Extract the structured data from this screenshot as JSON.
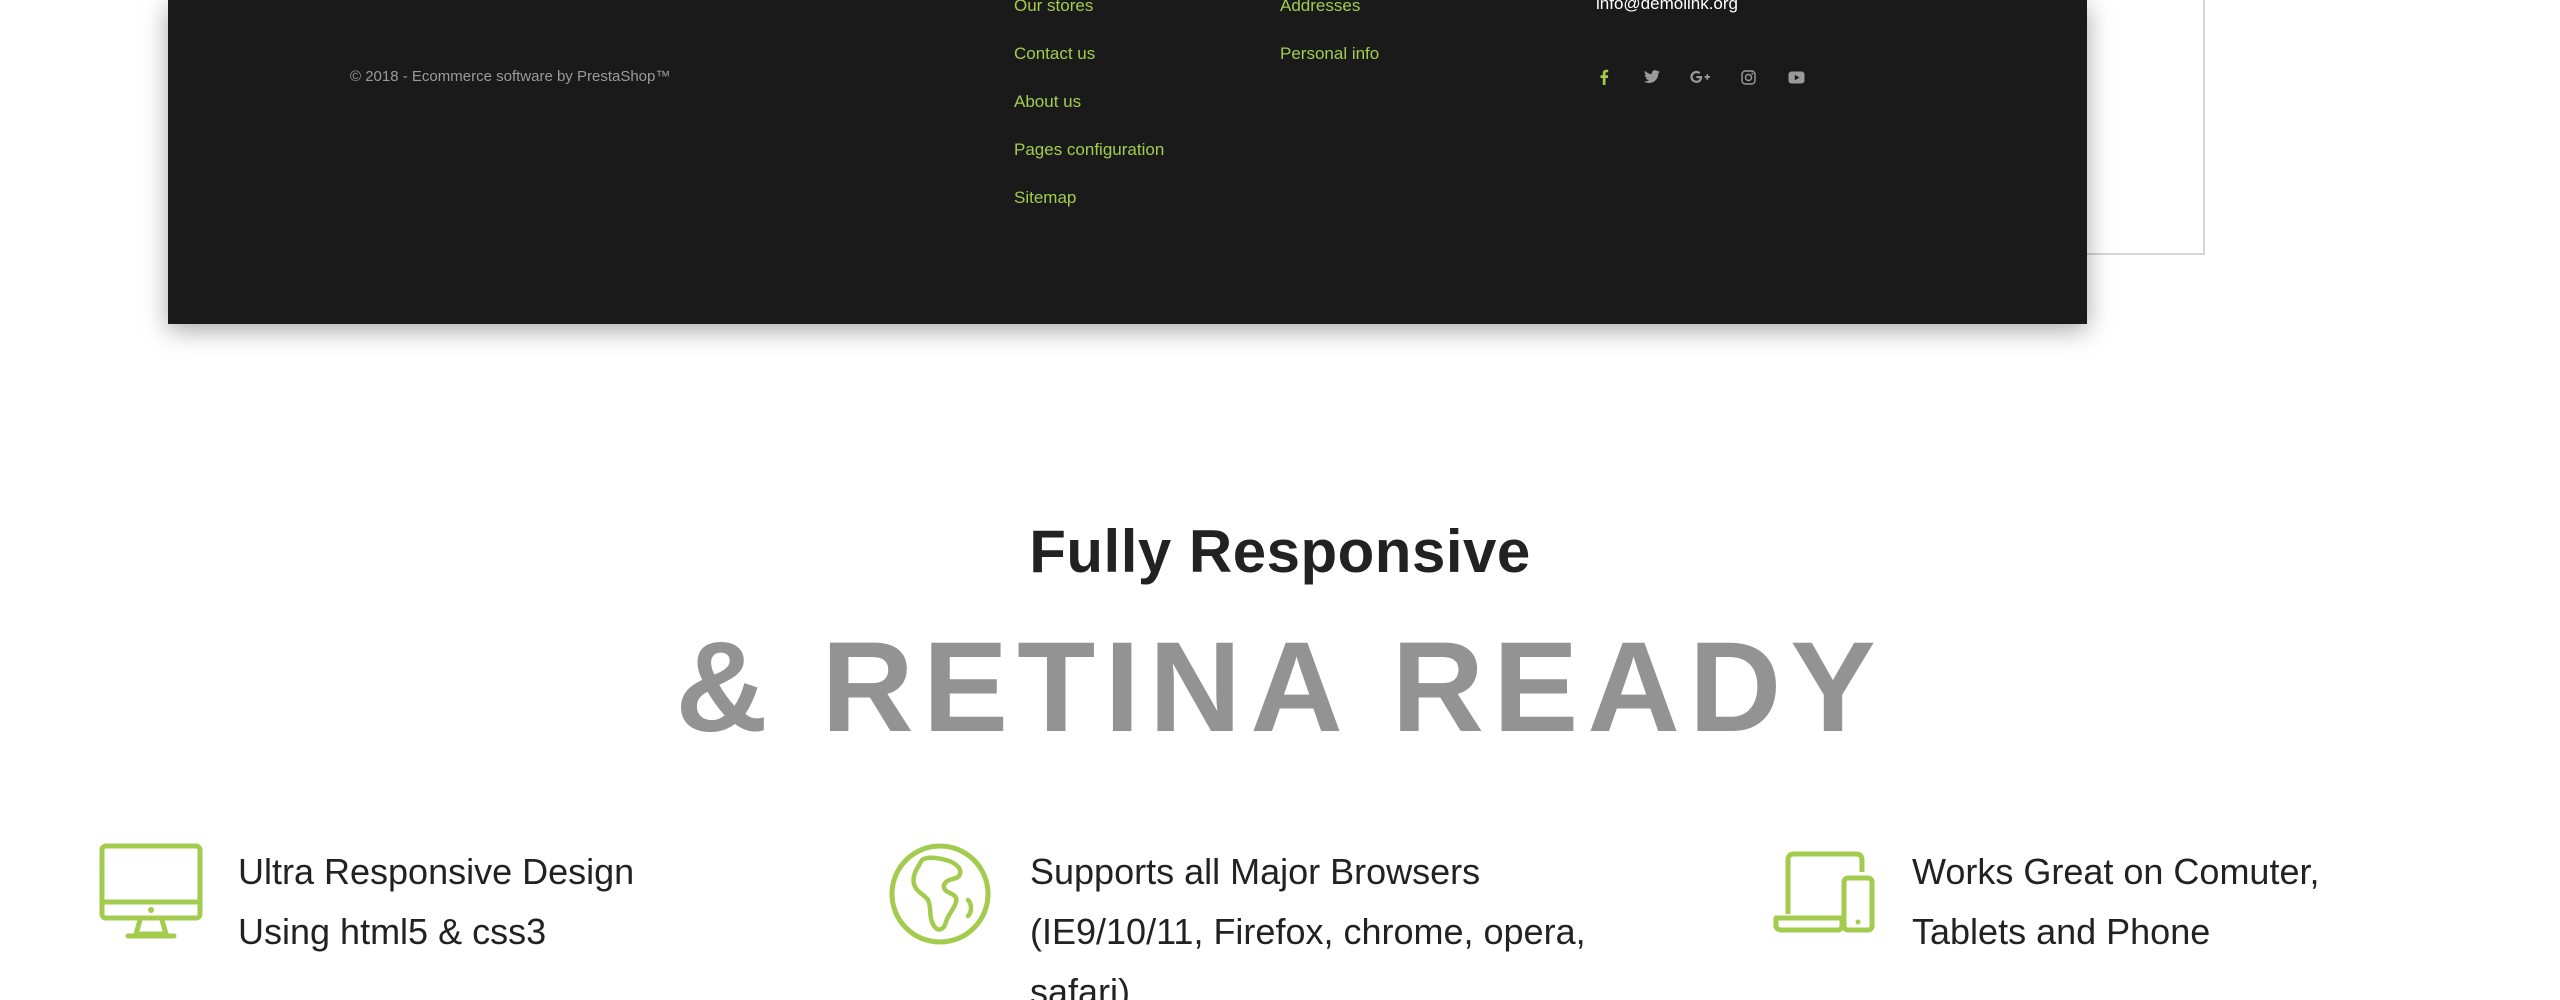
{
  "footer": {
    "copyright": "© 2018 - Ecommerce software by PrestaShop™",
    "links_column": [
      "Our stores",
      "Contact us",
      "About us",
      "Pages configuration",
      "Sitemap"
    ],
    "account_column": [
      "Addresses",
      "Personal info"
    ],
    "contact_email": "info@demolink.org",
    "social_icons": [
      "facebook-icon",
      "twitter-icon",
      "google-plus-icon",
      "instagram-icon",
      "youtube-icon"
    ],
    "link_color": "#a3cc4e",
    "background_color": "#1a1a1a"
  },
  "hero": {
    "title": "Fully Responsive",
    "subtitle": "& RETINA READY"
  },
  "features": [
    {
      "icon": "monitor-icon",
      "lines": [
        "Ultra Responsive Design",
        "Using html5 & css3"
      ]
    },
    {
      "icon": "globe-icon",
      "lines": [
        "Supports all Major Browsers",
        "(IE9/10/11, Firefox, chrome, opera,",
        "safari)"
      ]
    },
    {
      "icon": "devices-icon",
      "lines": [
        "Works Great on Comuter,",
        "Tablets and Phone"
      ]
    }
  ],
  "accent_color": "#a3cc4e"
}
